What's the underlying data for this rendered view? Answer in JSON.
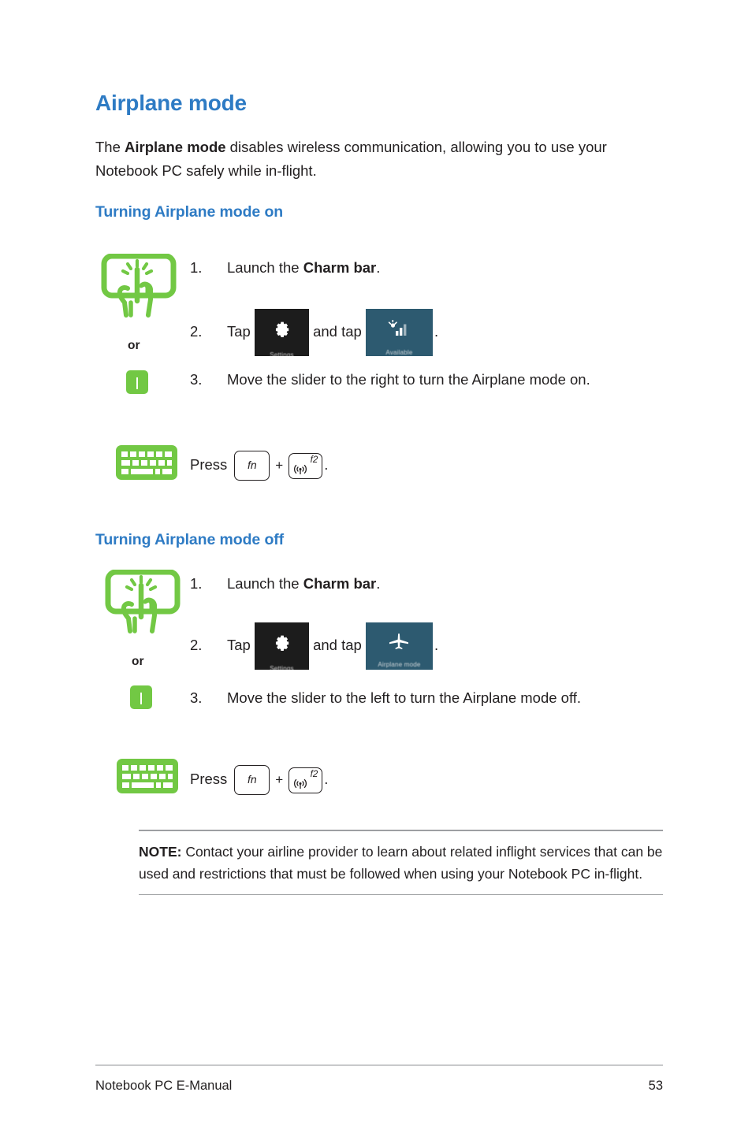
{
  "document": {
    "title": "Airplane mode",
    "intro_prefix": "The ",
    "intro_bold": "Airplane mode",
    "intro_suffix": " disables wireless communication, allowing you to use your Notebook PC safely while in-flight."
  },
  "colors": {
    "heading_blue": "#2e7bc4",
    "icon_green": "#72c844",
    "tile_dark": "#1c1c1c",
    "tile_blue": "#2d5a70",
    "body_text": "#221f20",
    "rule_gray": "#9d9fa2"
  },
  "sections": [
    {
      "heading": "Turning Airplane mode on",
      "or_label": "or",
      "icons": {
        "touchscreen": "touchscreen-tap-icon",
        "touchpad": "touchpad-icon",
        "keyboard": "keyboard-icon"
      },
      "steps": [
        {
          "num": "1.",
          "text_a": "Launch the ",
          "bold": "Charm bar",
          "text_b": "."
        },
        {
          "num": "2.",
          "text_a": "Tap ",
          "text_mid": " and tap ",
          "text_b": "."
        },
        {
          "num": "3.",
          "text_a": "Move the slider to the right to turn the Airplane mode on."
        }
      ],
      "tiles": {
        "settings": {
          "label": "Settings",
          "glyph": "gear-icon"
        },
        "target": {
          "label": "Available",
          "glyph": "wifi-icon",
          "kind": "wifi"
        }
      },
      "shortcut": {
        "press_label": "Press",
        "key1": "fn",
        "plus": "+",
        "key2": "f2",
        "key2_glyph": "wireless-antenna-icon",
        "period": "."
      }
    },
    {
      "heading": "Turning Airplane mode off",
      "or_label": "or",
      "icons": {
        "touchscreen": "touchscreen-tap-icon",
        "touchpad": "touchpad-icon",
        "keyboard": "keyboard-icon"
      },
      "steps": [
        {
          "num": "1.",
          "text_a": "Launch the ",
          "bold": "Charm bar",
          "text_b": "."
        },
        {
          "num": "2.",
          "text_a": "Tap ",
          "text_mid": " and tap ",
          "text_b": "."
        },
        {
          "num": "3.",
          "text_a": " Move the slider to the left to turn the Airplane mode off."
        }
      ],
      "tiles": {
        "settings": {
          "label": "Settings",
          "glyph": "gear-icon"
        },
        "target": {
          "label": "Airplane mode",
          "glyph": "airplane-icon",
          "kind": "plane"
        }
      },
      "shortcut": {
        "press_label": "Press",
        "key1": "fn",
        "plus": "+",
        "key2": "f2",
        "key2_glyph": "wireless-antenna-icon",
        "period": "."
      }
    }
  ],
  "note": {
    "label": "NOTE:",
    "text": " Contact your airline provider to learn about related inflight services that can be used and restrictions that must be followed when using your Notebook PC in-flight."
  },
  "footer": {
    "left": "Notebook PC E-Manual",
    "page": "53"
  }
}
